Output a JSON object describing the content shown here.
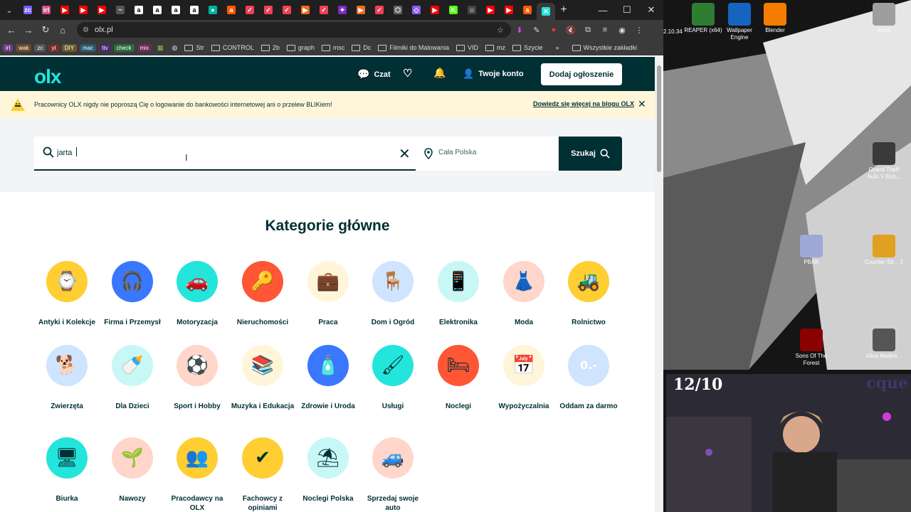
{
  "browser": {
    "tabs": [
      {
        "icon": "tab-icon-twitch",
        "color": "#7a5cff",
        "glyph": "zc",
        "active": false
      },
      {
        "icon": "tab-icon-irl",
        "color": "#d04a8a",
        "glyph": "irl",
        "active": false
      },
      {
        "icon": "tab-icon-youtube",
        "color": "#ff0000",
        "glyph": "▶",
        "active": false
      },
      {
        "icon": "tab-icon-youtube",
        "color": "#ff0000",
        "glyph": "▶",
        "active": false
      },
      {
        "icon": "tab-icon-youtube",
        "color": "#ff0000",
        "glyph": "▶",
        "active": false
      },
      {
        "icon": "tab-icon-generic",
        "color": "#555555",
        "glyph": "~",
        "active": false
      },
      {
        "icon": "tab-icon-amazon",
        "color": "#ffffff",
        "glyph": "a",
        "active": false
      },
      {
        "icon": "tab-icon-amazon",
        "color": "#ffffff",
        "glyph": "a",
        "active": false
      },
      {
        "icon": "tab-icon-amazon",
        "color": "#ffffff",
        "glyph": "a",
        "active": false
      },
      {
        "icon": "tab-icon-amazon",
        "color": "#ffffff",
        "glyph": "a",
        "active": false
      },
      {
        "icon": "tab-icon-teal",
        "color": "#00b3a4",
        "glyph": "●",
        "active": false
      },
      {
        "icon": "tab-icon-allegro",
        "color": "#ff5a00",
        "glyph": "a",
        "active": false
      },
      {
        "icon": "tab-icon-pocket",
        "color": "#ef4056",
        "glyph": "✓",
        "active": false
      },
      {
        "icon": "tab-icon-pocket",
        "color": "#ef4056",
        "glyph": "✓",
        "active": false
      },
      {
        "icon": "tab-icon-pocket",
        "color": "#ef4056",
        "glyph": "✓",
        "active": false
      },
      {
        "icon": "tab-icon-orange",
        "color": "#f26b1d",
        "glyph": "▶",
        "active": false
      },
      {
        "icon": "tab-icon-pocket",
        "color": "#ef4056",
        "glyph": "✓",
        "active": false
      },
      {
        "icon": "tab-icon-generic",
        "color": "#7b2cbf",
        "glyph": "✦",
        "active": false
      },
      {
        "icon": "tab-icon-orange",
        "color": "#f26b1d",
        "glyph": "▶",
        "active": false
      },
      {
        "icon": "tab-icon-pocket",
        "color": "#ef4056",
        "glyph": "✓",
        "active": false
      },
      {
        "icon": "tab-icon-generic",
        "color": "#666666",
        "glyph": "⬡",
        "active": false
      },
      {
        "icon": "tab-icon-generic",
        "color": "#8a5cf6",
        "glyph": "◇",
        "active": false
      },
      {
        "icon": "tab-icon-youtube",
        "color": "#ff0000",
        "glyph": "▶",
        "active": false
      },
      {
        "icon": "tab-icon-kick",
        "color": "#53fc18",
        "glyph": "K",
        "active": false
      },
      {
        "icon": "tab-icon-generic",
        "color": "#444444",
        "glyph": "☺",
        "active": false
      },
      {
        "icon": "tab-icon-youtube",
        "color": "#ff0000",
        "glyph": "▶",
        "active": false
      },
      {
        "icon": "tab-icon-youtube",
        "color": "#ff0000",
        "glyph": "▶",
        "active": false
      },
      {
        "icon": "tab-icon-allegro",
        "color": "#ff5a00",
        "glyph": "a",
        "active": false
      },
      {
        "icon": "tab-icon-olx",
        "color": "#23e5db",
        "glyph": "✕",
        "active": true
      }
    ],
    "url": "olx.pl",
    "bookmark_chips": [
      {
        "label": "irl",
        "color": "#6b3e8a"
      },
      {
        "label": "wak",
        "color": "#6b4a2a"
      },
      {
        "label": "zc",
        "color": "#555555"
      },
      {
        "label": "yt",
        "color": "#7a2a2a"
      },
      {
        "label": "DIY",
        "color": "#6b5a2a"
      },
      {
        "label": "mac",
        "color": "#2a5a6b"
      },
      {
        "label": "ttv",
        "color": "#4a2a6b"
      },
      {
        "label": "check",
        "color": "#2a6b3a"
      },
      {
        "label": "mix",
        "color": "#6b2a5a"
      }
    ],
    "bookmark_folders": [
      "Str",
      "CONTROL",
      "2b",
      "graph",
      "msc",
      "Dc",
      "Filmiki do Malowania",
      "VID",
      "mz",
      "Szycie"
    ],
    "bookmark_overflow": "»",
    "all_bookmarks": "Wszystkie zakładki"
  },
  "header": {
    "logo": "olx",
    "chat": "Czat",
    "account": "Twoje konto",
    "post_ad": "Dodaj ogłoszenie"
  },
  "notice": {
    "message": "Pracownicy OLX nigdy nie poproszą Cię o logowanie do bankowości internetowej ani o przelew BLIKiem!",
    "link": "Dowiedz się więcej na blogu OLX"
  },
  "search": {
    "query": "jarta",
    "location": "Cała Polska",
    "button": "Szukaj"
  },
  "categories_title": "Kategorie główne",
  "categories": [
    {
      "name": "antyki",
      "label": "Antyki i Kolekcje",
      "bg": "#ffce32",
      "icon": "pocket-watch-icon",
      "glyph": "⌚"
    },
    {
      "name": "firma",
      "label": "Firma i Przemysł",
      "bg": "#3a77ff",
      "icon": "ear-muffs-icon",
      "glyph": "🎧"
    },
    {
      "name": "motoryzacja",
      "label": "Motoryzacja",
      "bg": "#23e5db",
      "icon": "car-icon",
      "glyph": "🚗"
    },
    {
      "name": "nieruchomosci",
      "label": "Nieruchomości",
      "bg": "#ff5636",
      "icon": "keys-icon",
      "glyph": "🔑"
    },
    {
      "name": "praca",
      "label": "Praca",
      "bg": "#fff6d9",
      "icon": "briefcase-icon",
      "glyph": "💼"
    },
    {
      "name": "dom",
      "label": "Dom i Ogród",
      "bg": "#cee4ff",
      "icon": "armchair-icon",
      "glyph": "🪑"
    },
    {
      "name": "elektronika",
      "label": "Elektronika",
      "bg": "#c8f8f6",
      "icon": "smartphone-icon",
      "glyph": "📱"
    },
    {
      "name": "moda",
      "label": "Moda",
      "bg": "#ffd6c9",
      "icon": "dress-icon",
      "glyph": "👗"
    },
    {
      "name": "rolnictwo",
      "label": "Rolnictwo",
      "bg": "#ffce32",
      "icon": "tractor-icon",
      "glyph": "🚜"
    },
    {
      "name": "zwierzeta",
      "label": "Zwierzęta",
      "bg": "#cee4ff",
      "icon": "dog-icon",
      "glyph": "🐕"
    },
    {
      "name": "dla-dzieci",
      "label": "Dla Dzieci",
      "bg": "#c8f8f6",
      "icon": "stroller-icon",
      "glyph": "🍼"
    },
    {
      "name": "sport",
      "label": "Sport i Hobby",
      "bg": "#ffd6c9",
      "icon": "football-icon",
      "glyph": "⚽"
    },
    {
      "name": "muzyka",
      "label": "Muzyka i Edukacja",
      "bg": "#fff6d9",
      "icon": "books-icon",
      "glyph": "📚"
    },
    {
      "name": "zdrowie",
      "label": "Zdrowie i Uroda",
      "bg": "#3a77ff",
      "icon": "perfume-icon",
      "glyph": "🧴"
    },
    {
      "name": "uslugi",
      "label": "Usługi",
      "bg": "#23e5db",
      "icon": "paint-roller-icon",
      "glyph": "🖌"
    },
    {
      "name": "noclegi",
      "label": "Noclegi",
      "bg": "#ff5636",
      "icon": "bed-icon",
      "glyph": "🛏"
    },
    {
      "name": "wypozyczalnia",
      "label": "Wypożyczalnia",
      "bg": "#fff6d9",
      "icon": "calendar-icon",
      "glyph": "📅"
    },
    {
      "name": "oddam",
      "label": "Oddam za darmo",
      "bg": "#cee4ff",
      "icon": "price-tag-icon",
      "glyph": "0.-"
    },
    {
      "name": "biurka",
      "label": "Biurka",
      "bg": "#23e5db",
      "icon": "desk-icon",
      "glyph": "🖥"
    },
    {
      "name": "nawozy",
      "label": "Nawozy",
      "bg": "#ffd6c9",
      "icon": "seedling-icon",
      "glyph": "🌱"
    },
    {
      "name": "pracodawcy",
      "label": "Pracodawcy na OLX",
      "bg": "#ffce32",
      "icon": "people-icon",
      "glyph": "👥"
    },
    {
      "name": "fachowcy",
      "label": "Fachowcy z opiniami",
      "bg": "#ffce32",
      "icon": "check-badge-icon",
      "glyph": "✔"
    },
    {
      "name": "noclegi-polska",
      "label": "Noclegi Polska",
      "bg": "#c8f8f6",
      "icon": "beach-chair-icon",
      "glyph": "⛱"
    },
    {
      "name": "sprzedaj-auto",
      "label": "Sprzedaj swoje auto",
      "bg": "#ffd6c9",
      "icon": "car-key-icon",
      "glyph": "🚙"
    }
  ],
  "desktop": {
    "icons": [
      {
        "name": "reaper",
        "label": "REAPER (x64)",
        "color": "#2e7d32"
      },
      {
        "name": "wallpaper-engine",
        "label": "Wallpaper Engine",
        "color": "#1565c0"
      },
      {
        "name": "blender",
        "label": "Blender",
        "color": "#f57c00"
      },
      {
        "name": "recycle-bin",
        "label": "Kosz",
        "color": "#9e9e9e"
      },
      {
        "name": "gta",
        "label": "Grand Theft Auto V Enh...",
        "color": "#3a3a3a"
      },
      {
        "name": "pbak",
        "label": "PBAK",
        "color": "#a0a8d8"
      },
      {
        "name": "counter-strike",
        "label": "Counter-Str... 2",
        "color": "#e0a020"
      },
      {
        "name": "sons-of-the-forest",
        "label": "Sons Of The Forest",
        "color": "#8b0000"
      },
      {
        "name": "alice-madness",
        "label": "Alice Madne...",
        "color": "#555555"
      }
    ],
    "partial_label": "2.10.34",
    "webcam_score": "12/10",
    "webcam_brand": "cque"
  }
}
